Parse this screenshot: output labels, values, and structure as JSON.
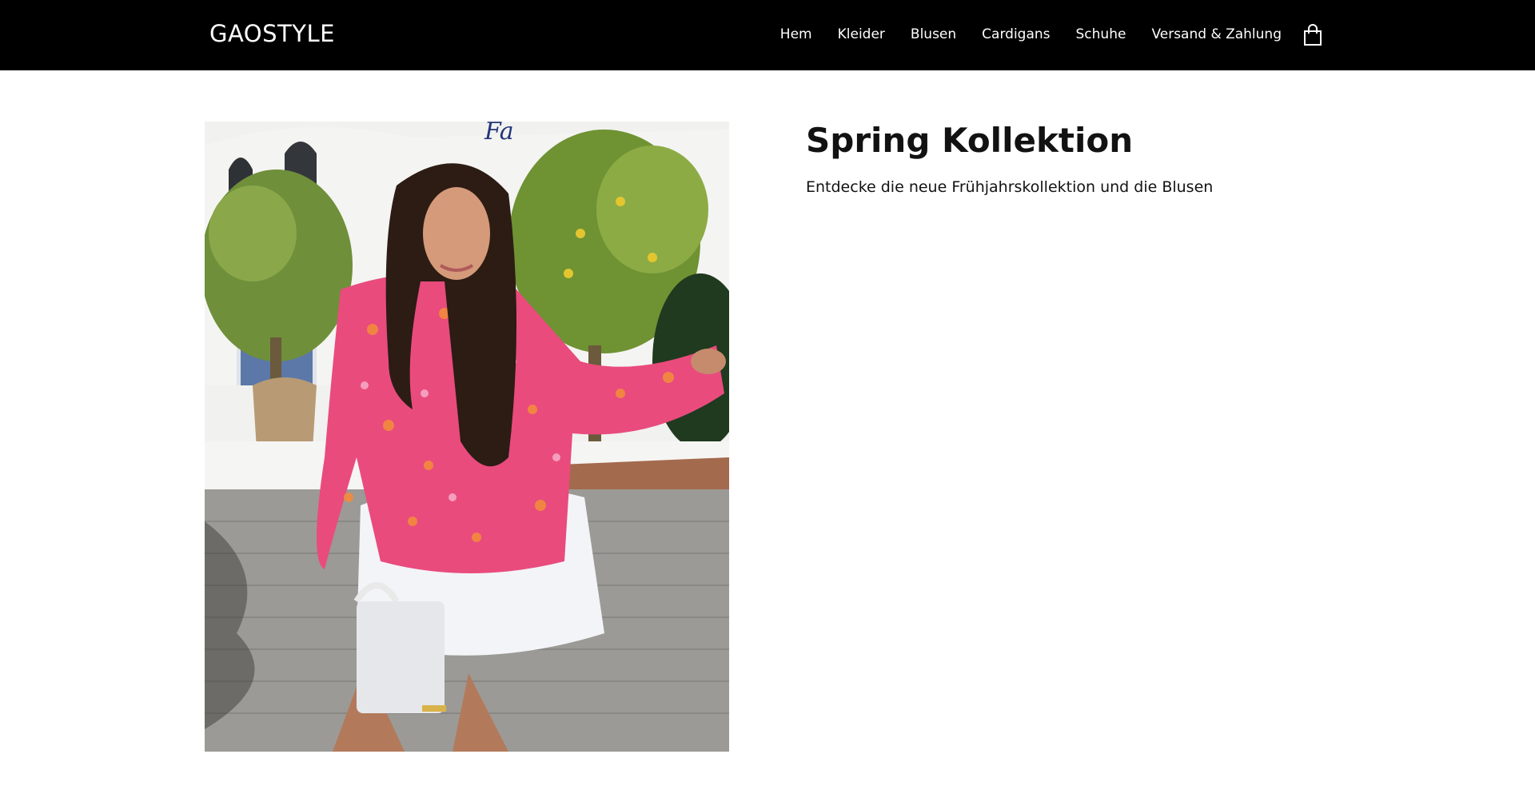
{
  "header": {
    "logo": "GAOSTYLE",
    "nav": [
      {
        "label": "Hem"
      },
      {
        "label": "Kleider"
      },
      {
        "label": "Blusen"
      },
      {
        "label": "Cardigans"
      },
      {
        "label": "Schuhe"
      },
      {
        "label": "Versand & Zahlung"
      }
    ],
    "cart_icon": "shopping-bag-icon"
  },
  "hero": {
    "title": "Spring Kollektion",
    "subtitle": "Entdecke die neue Frühjahrskollektion und die Blusen"
  },
  "colors": {
    "header_bg": "#000000",
    "header_text": "#ffffff",
    "page_bg": "#ffffff",
    "text": "#121212",
    "blouse_pink": "#e8487a"
  }
}
